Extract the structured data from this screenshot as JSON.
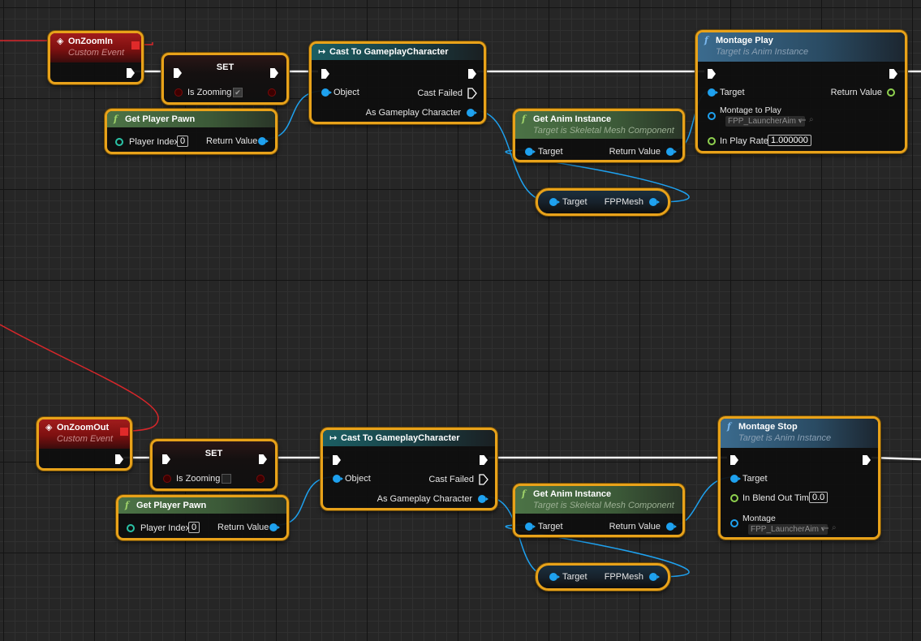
{
  "app": {
    "type": "Blueprint Event Graph"
  },
  "colors": {
    "exec_wire": "#f2f2f2",
    "object_wire": "#1ea1ef",
    "delegate_wire": "#e02a2a",
    "node_selected_border": "#e8a21a",
    "float_pin": "#8fd14f",
    "bool_pin": "#7a0a0a",
    "int_pin": "#2ac3a6"
  },
  "graphs": [
    {
      "event": {
        "title": "OnZoomIn",
        "subtitle": "Custom Event",
        "icon": "event-diamond-icon"
      },
      "set": {
        "title": "SET",
        "variable": "Is Zooming",
        "value": true,
        "value_glyph": "✔"
      },
      "get_player_pawn": {
        "title": "Get Player Pawn",
        "icon": "function-icon",
        "input_label": "Player Index",
        "input_value": "0",
        "output_label": "Return Value"
      },
      "cast": {
        "title": "Cast To GameplayCharacter",
        "icon": "cast-arrow-icon",
        "input_label": "Object",
        "failed_label": "Cast Failed",
        "output_label": "As Gameplay Character"
      },
      "get_anim_instance": {
        "title": "Get Anim Instance",
        "subtitle": "Target is Skeletal Mesh Component",
        "input_label": "Target",
        "output_label": "Return Value"
      },
      "mesh_getter": {
        "input_label": "Target",
        "output_label": "FPPMesh"
      },
      "montage": {
        "title": "Montage Play",
        "subtitle": "Target is Anim Instance",
        "target_label": "Target",
        "return_label": "Return Value",
        "asset_label": "Montage to Play",
        "asset_value": "FPP_LauncherAim",
        "float_label": "In Play Rate",
        "float_value": "1.000000"
      }
    },
    {
      "event": {
        "title": "OnZoomOut",
        "subtitle": "Custom Event",
        "icon": "event-diamond-icon"
      },
      "set": {
        "title": "SET",
        "variable": "Is Zooming",
        "value": false,
        "value_glyph": ""
      },
      "get_player_pawn": {
        "title": "Get Player Pawn",
        "icon": "function-icon",
        "input_label": "Player Index",
        "input_value": "0",
        "output_label": "Return Value"
      },
      "cast": {
        "title": "Cast To GameplayCharacter",
        "icon": "cast-arrow-icon",
        "input_label": "Object",
        "failed_label": "Cast Failed",
        "output_label": "As Gameplay Character"
      },
      "get_anim_instance": {
        "title": "Get Anim Instance",
        "subtitle": "Target is Skeletal Mesh Component",
        "input_label": "Target",
        "output_label": "Return Value"
      },
      "mesh_getter": {
        "input_label": "Target",
        "output_label": "FPPMesh"
      },
      "montage": {
        "title": "Montage Stop",
        "subtitle": "Target is Anim Instance",
        "target_label": "Target",
        "float_label": "In Blend Out Time",
        "float_value": "0.0",
        "asset_label": "Montage",
        "asset_value": "FPP_LauncherAim"
      }
    }
  ]
}
